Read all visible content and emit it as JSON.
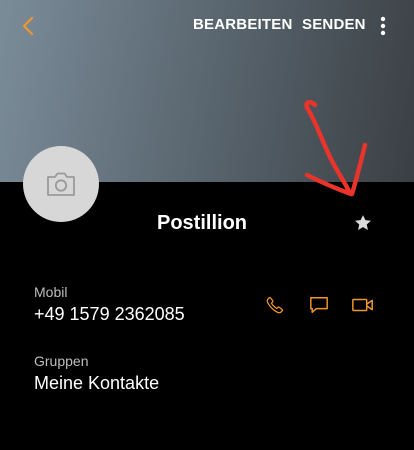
{
  "toolbar": {
    "edit_label": "BEARBEITEN",
    "send_label": "SENDEN"
  },
  "contact": {
    "name": "Postillion",
    "mobile_label": "Mobil",
    "mobile_number": "+49 1579 2362085",
    "groups_label": "Gruppen",
    "groups_value": "Meine Kontakte"
  },
  "icons": {
    "back": "chevron-left-icon",
    "more": "more-vertical-icon",
    "avatar": "camera-icon",
    "favorite": "star-icon",
    "call": "phone-icon",
    "message": "message-icon",
    "video": "video-call-icon"
  },
  "colors": {
    "accent": "#f0962e",
    "annotation": "#e8342a",
    "background": "#000000",
    "text": "#ffffff",
    "secondary_text": "#bdbdbd",
    "avatar_bg": "#d7d7d7"
  }
}
